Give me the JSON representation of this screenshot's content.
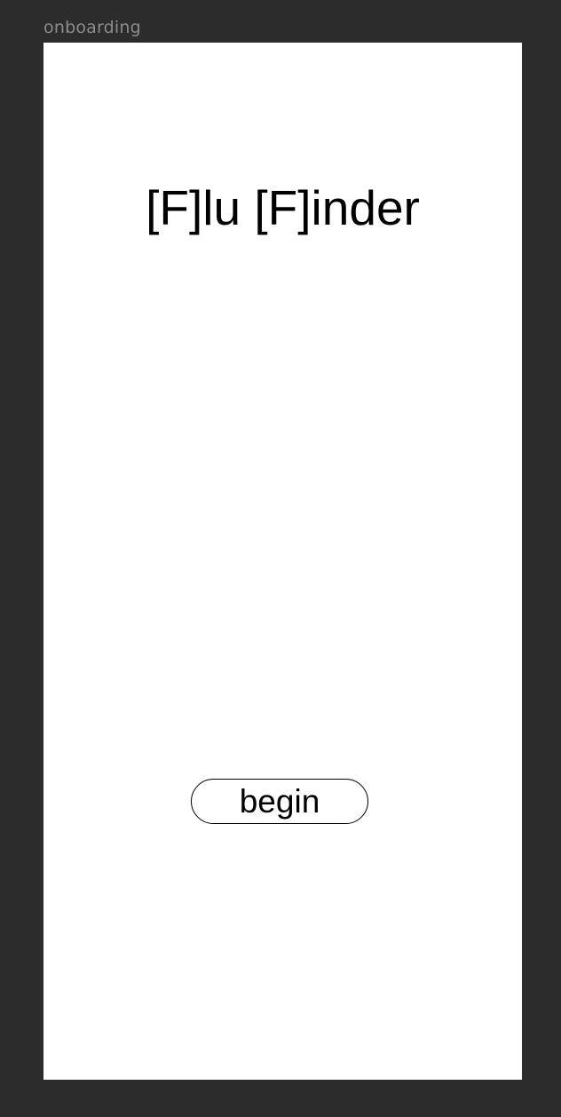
{
  "canvas": {
    "frame_label": "onboarding"
  },
  "screen": {
    "title": "[F]lu [F]inder",
    "begin_label": "begin"
  },
  "colors": {
    "canvas_background": "#2c2c2c",
    "frame_background": "#ffffff",
    "text": "#000000",
    "frame_label": "#8c8c8c"
  }
}
